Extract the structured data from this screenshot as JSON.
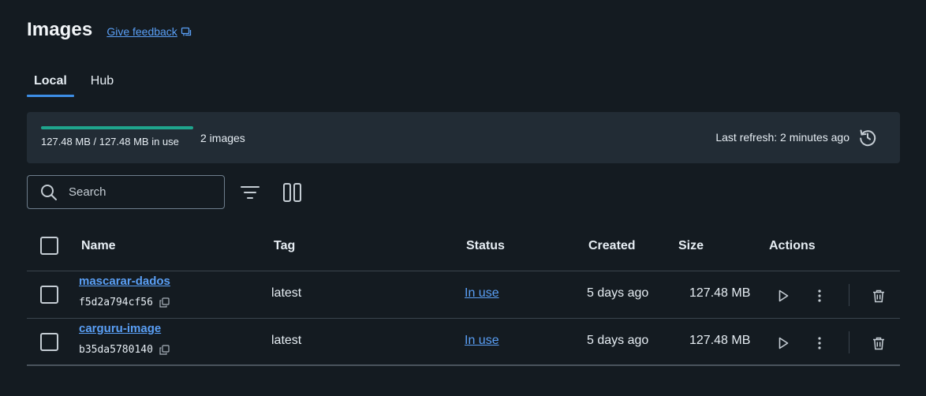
{
  "header": {
    "title": "Images",
    "feedback_label": "Give feedback"
  },
  "tabs": [
    {
      "label": "Local",
      "active": true
    },
    {
      "label": "Hub",
      "active": false
    }
  ],
  "usage": {
    "text": "127.48 MB / 127.48 MB in use",
    "fraction": 1.0,
    "image_count": "2 images",
    "last_refresh": "Last refresh: 2 minutes ago"
  },
  "search": {
    "placeholder": "Search"
  },
  "table": {
    "columns": {
      "name": "Name",
      "tag": "Tag",
      "status": "Status",
      "created": "Created",
      "size": "Size",
      "actions": "Actions"
    },
    "rows": [
      {
        "name": "mascarar-dados",
        "id": "f5d2a794cf56",
        "tag": "latest",
        "status": "In use",
        "created": "5 days ago",
        "size": "127.48 MB"
      },
      {
        "name": "carguru-image",
        "id": "b35da5780140",
        "tag": "latest",
        "status": "In use",
        "created": "5 days ago",
        "size": "127.48 MB"
      }
    ]
  },
  "icons": {
    "feedback": "feedback-icon",
    "refresh": "refresh-icon",
    "search": "search-icon",
    "filter": "filter-icon",
    "columns": "columns-icon",
    "copy": "copy-icon",
    "play": "play-icon",
    "more": "more-vertical-icon",
    "delete": "trash-icon"
  },
  "colors": {
    "background": "#141b21",
    "panel": "#222c35",
    "accent": "#3d8ee6",
    "link": "#5a9ff5",
    "meter": "#1fa58d"
  }
}
